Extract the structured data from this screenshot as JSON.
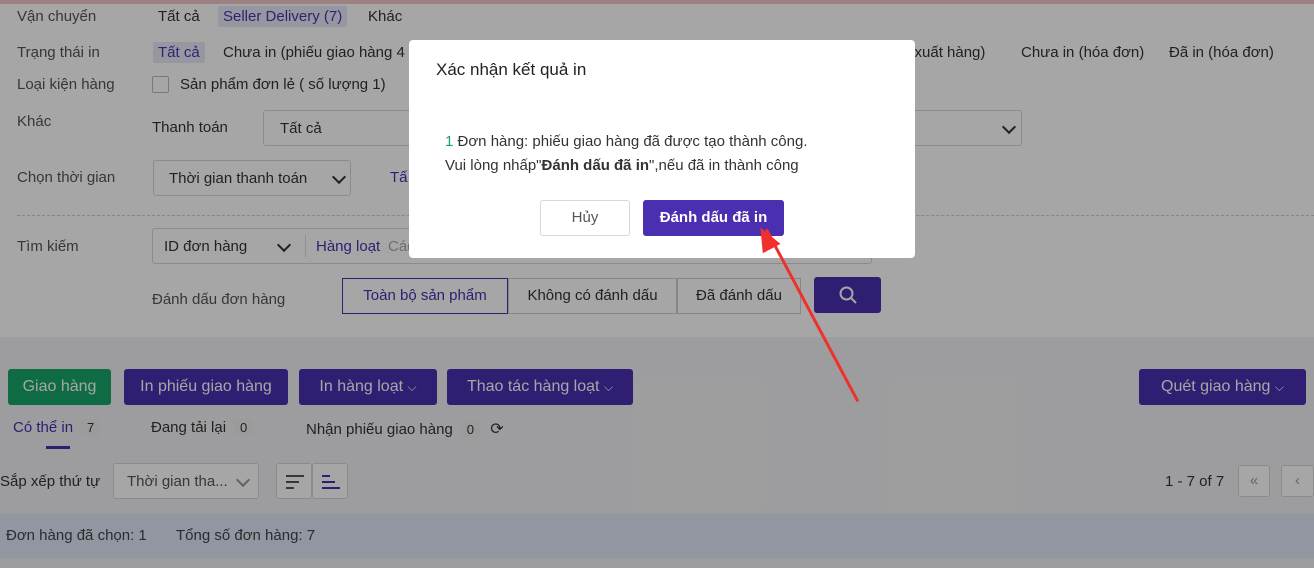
{
  "filters": {
    "shipping": {
      "label": "Vận chuyển",
      "options": [
        "Tất cả",
        "Seller Delivery (7)",
        "Khác"
      ]
    },
    "print_status": {
      "label": "Trạng thái in",
      "options": [
        "Tất cả",
        "Chưa in (phiếu giao hàng 4",
        "u xuất hàng)",
        "Chưa in (hóa đơn)",
        "Đã in (hóa đơn)"
      ]
    },
    "package_type": {
      "label": "Loại kiện hàng",
      "checkbox_label": "Sản phẩm đơn lẻ ( số lượng 1)"
    },
    "other": {
      "label": "Khác",
      "payment_label": "Thanh toán",
      "payment_value": "Tất cả"
    },
    "time": {
      "label": "Chọn thời gian",
      "value": "Thời gian thanh toán",
      "extra": "Tấ"
    },
    "search": {
      "label": "Tìm kiếm",
      "field": "ID đơn hàng",
      "bulk": "Hàng loạt",
      "placeholder": "Các"
    },
    "mark": {
      "label": "Đánh dấu đơn hàng",
      "segments": [
        "Toàn bộ sản phẩm",
        "Không có đánh dấu",
        "Đã đánh dấu"
      ]
    }
  },
  "toolbar": {
    "ship": "Giao hàng",
    "print_label": "In phiếu giao hàng",
    "bulk_print": "In hàng loạt",
    "bulk_actions": "Thao tác hàng loạt",
    "scan": "Quét giao hàng"
  },
  "tabs": [
    {
      "label": "Có thể in",
      "count": "7"
    },
    {
      "label": "Đang tải lại",
      "count": "0"
    },
    {
      "label": "Nhận phiếu giao hàng",
      "count": "0"
    }
  ],
  "sort": {
    "label": "Sắp xếp thứ tự",
    "value": "Thời gian tha..."
  },
  "pagination": {
    "range": "1 - 7 of 7"
  },
  "summary": {
    "selected": "Đơn hàng đã chọn: 1",
    "total": "Tổng số đơn hàng: 7"
  },
  "modal": {
    "title": "Xác nhận kết quả in",
    "count": "1",
    "line1": " Đơn hàng: phiếu giao hàng đã được tạo thành công.",
    "line2_prefix": "Vui lòng nhấp\"",
    "line2_bold": "Đánh dấu đã in",
    "line2_suffix": "\",nếu đã in thành công",
    "cancel": "Hủy",
    "confirm": "Đánh dấu đã in"
  },
  "colors": {
    "accent": "#4a2fb0",
    "green": "#17a567",
    "count": "#17a567",
    "arrow": "#f0302c"
  }
}
